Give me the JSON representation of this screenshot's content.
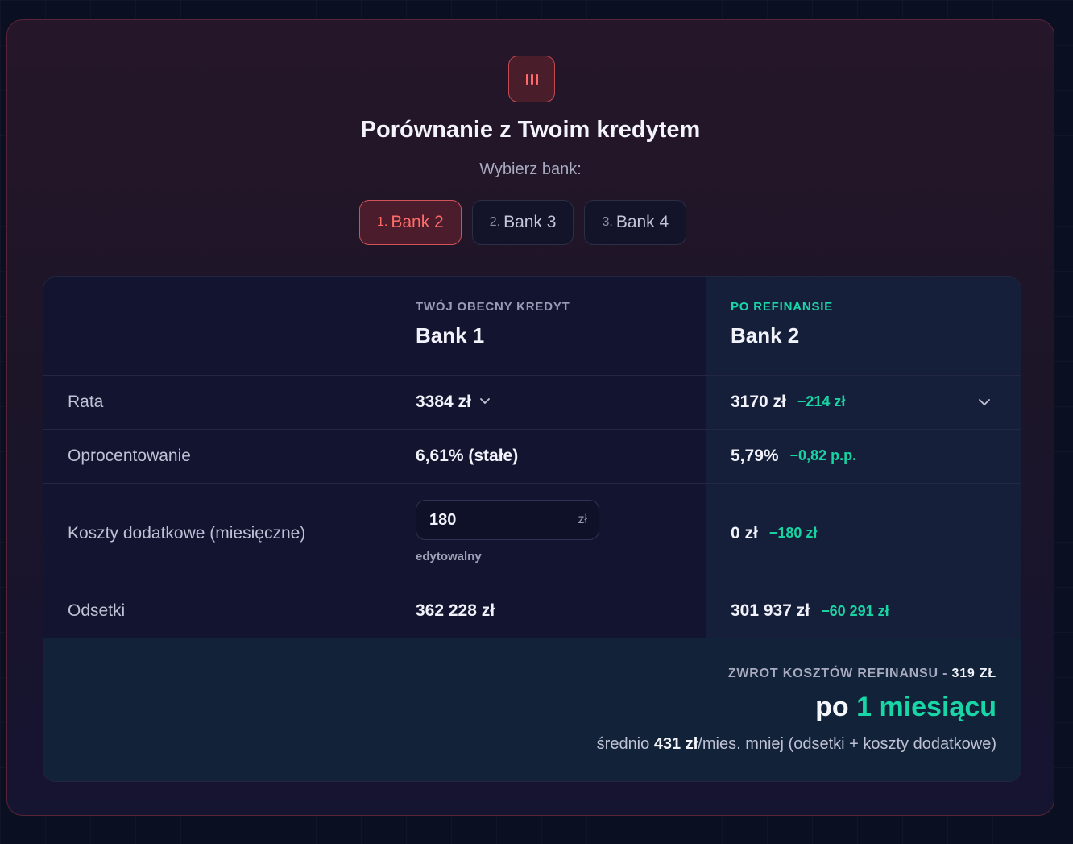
{
  "header": {
    "icon": "bars-icon",
    "title": "Porównanie z Twoim kredytem",
    "subtitle": "Wybierz bank:"
  },
  "bank_tabs": [
    {
      "num": "1.",
      "label": "Bank 2",
      "active": true
    },
    {
      "num": "2.",
      "label": "Bank 3",
      "active": false
    },
    {
      "num": "3.",
      "label": "Bank 4",
      "active": false
    }
  ],
  "table": {
    "current": {
      "tag": "TWÓJ OBECNY KREDYT",
      "bank": "Bank 1"
    },
    "new": {
      "tag": "PO REFINANSIE",
      "bank": "Bank 2"
    },
    "rows": {
      "rata": {
        "label": "Rata",
        "current": "3384 zł",
        "new": "3170 zł",
        "delta": "−214 zł"
      },
      "oprocentowanie": {
        "label": "Oprocentowanie",
        "current": "6,61% (stałe)",
        "new": "5,79%",
        "delta": "−0,82 p.p."
      },
      "koszty": {
        "label": "Koszty dodatkowe (miesięczne)",
        "input_value": "180",
        "unit": "zł",
        "hint": "edytowalny",
        "new": "0 zł",
        "delta": "−180 zł"
      },
      "odsetki": {
        "label": "Odsetki",
        "current": "362 228 zł",
        "new": "301 937 zł",
        "delta": "−60 291 zł"
      }
    }
  },
  "summary": {
    "label": "ZWROT KOSZTÓW REFINANSU -",
    "amount": "319 ZŁ",
    "prefix": "po",
    "period": "1 miesiącu",
    "avg_prefix": "średnio",
    "avg_value": "431 zł",
    "avg_suffix": "/mies. mniej (odsetki + koszty dodatkowe)"
  },
  "colors": {
    "accent_red": "#ff6b66",
    "accent_teal": "#19d6a6",
    "background": "#0b0f22"
  }
}
